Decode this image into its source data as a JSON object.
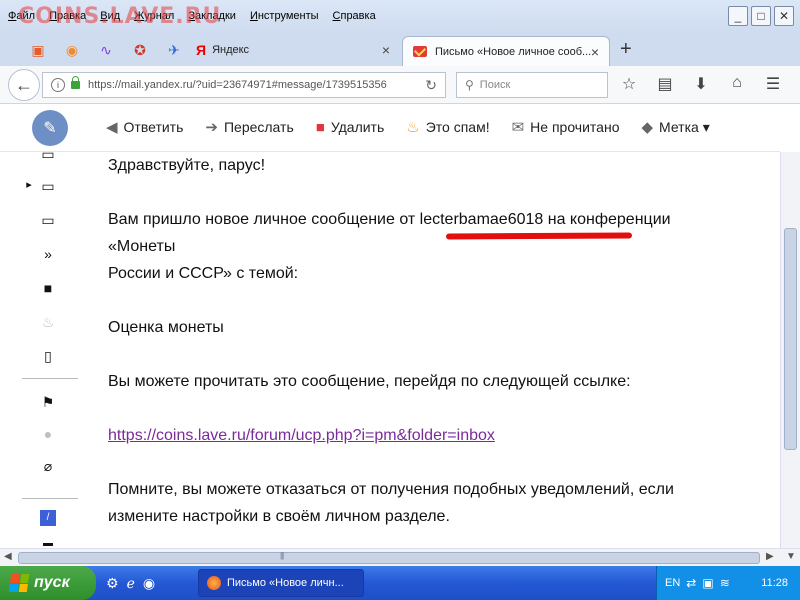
{
  "menubar": {
    "items": [
      "Файл",
      "Правка",
      "Вид",
      "Журнал",
      "Закладки",
      "Инструменты",
      "Справка"
    ],
    "watermark": "COINS.LAVE.RU"
  },
  "window_controls": {
    "minimize": "_",
    "maximize": "□",
    "close": "✕"
  },
  "tabs": {
    "pinned_icons": [
      "bookmark-icon",
      "rss-icon",
      "chart-icon",
      "award-icon",
      "plane-icon"
    ],
    "yandex_tab": {
      "logo": "Я",
      "label": "Яндекс",
      "close": "×"
    },
    "active_tab": {
      "label": "Письмо «Новое личное сооб...",
      "close": "×"
    },
    "new_tab": "+"
  },
  "navbar": {
    "back": "←",
    "url": "https://mail.yandex.ru/?uid=23674971#message/1739515356",
    "reload": "↻",
    "search_placeholder": "Поиск",
    "icons": [
      "star-icon",
      "reader-icon",
      "download-icon",
      "home-icon",
      "menu-icon"
    ]
  },
  "mail_toolbar": {
    "compose_icon": "✎",
    "actions": [
      {
        "icon": "reply-icon",
        "label": "Ответить"
      },
      {
        "icon": "forward-icon",
        "label": "Переслать"
      },
      {
        "icon": "trash-icon",
        "label": "Удалить"
      },
      {
        "icon": "spam-icon",
        "label": "Это спам!"
      },
      {
        "icon": "envelope-icon",
        "label": "Не прочитано"
      },
      {
        "icon": "tag-icon",
        "label": "Метка ▾"
      }
    ]
  },
  "message": {
    "greeting": "Здравствуйте, парус!",
    "line1": "Вам пришло новое личное сообщение от lecterbamae6018 на конференции",
    "line2": "«Монеты",
    "line3": "России и СССР» с темой:",
    "subject": "Оценка монеты",
    "read_prompt": "Вы можете прочитать это сообщение, перейдя по следующей ссылке:",
    "link": "https://coins.lave.ru/forum/ucp.php?i=pm&folder=inbox",
    "footer1": "Помните, вы можете отказаться от получения подобных уведомлений, если",
    "footer2": "измените настройки в своём личном разделе."
  },
  "taskbar": {
    "start_label": "пуск",
    "task_label": "Письмо «Новое личн...",
    "lang": "EN",
    "clock": "11:28"
  },
  "colors": {
    "accent": "#6d8fc6",
    "link": "#7b2a9a",
    "annotation": "#e40e0e",
    "taskbar": "#2458d4",
    "start": "#2d8f2a"
  }
}
